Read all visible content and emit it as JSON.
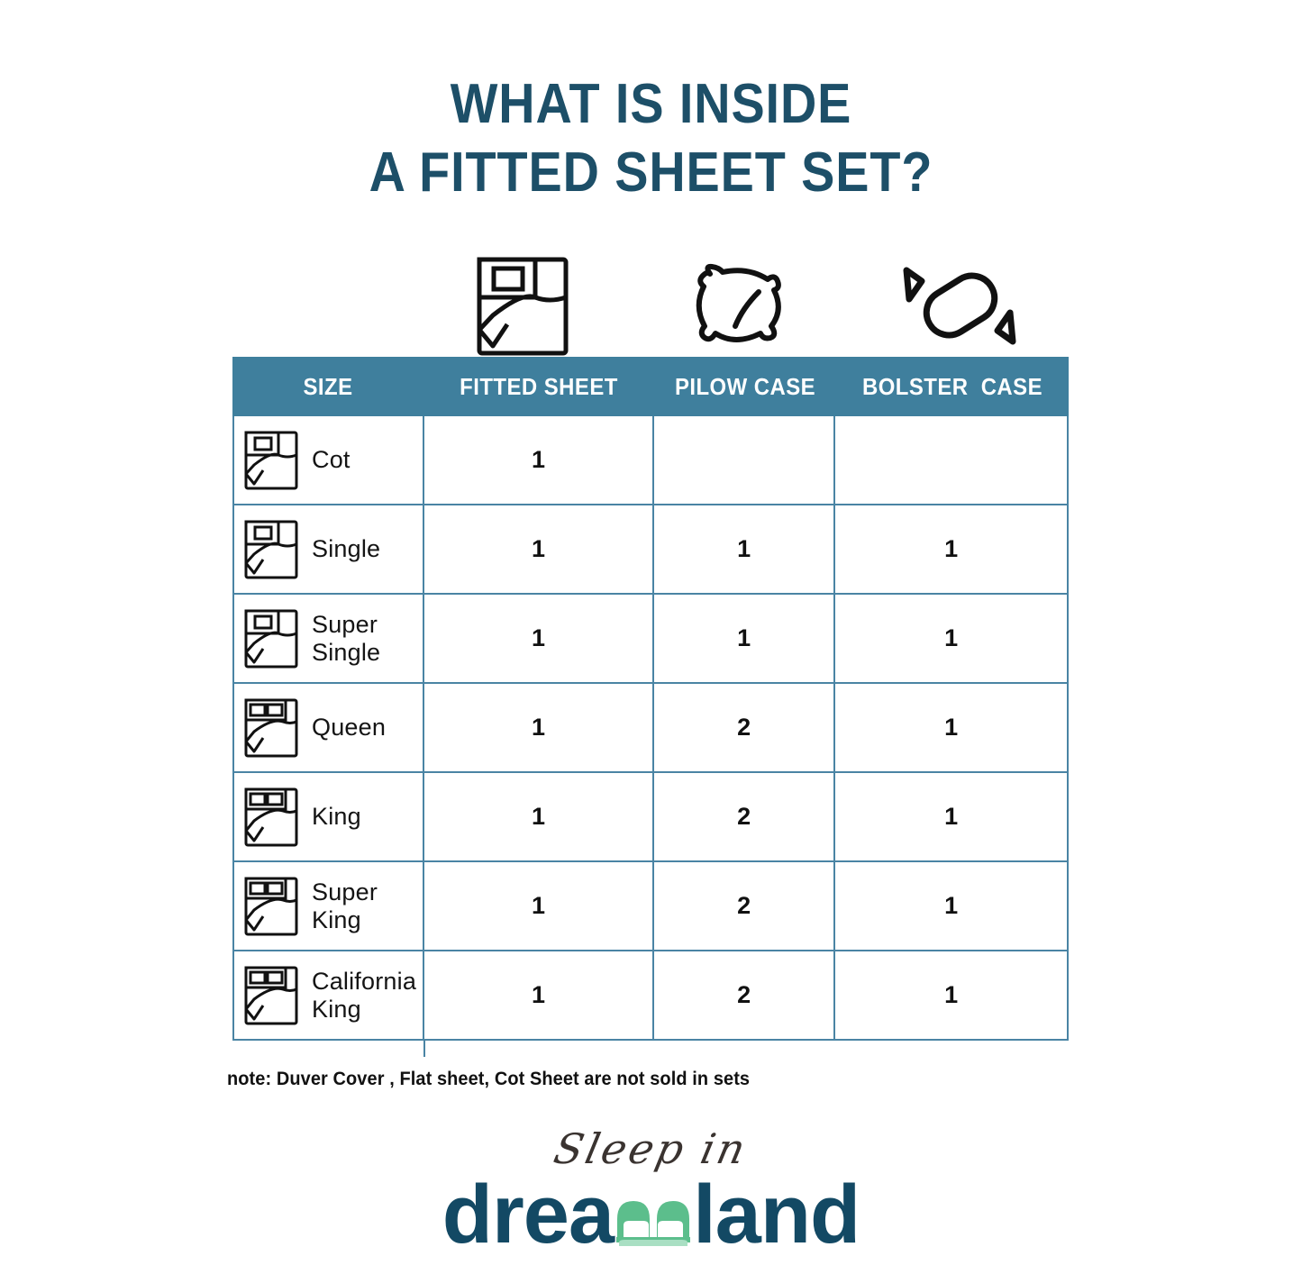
{
  "title": {
    "line1": "WHAT IS INSIDE",
    "line2": "A FITTED SHEET SET?",
    "color": "#1d4f68"
  },
  "header_icons": [
    {
      "name": "bed-icon",
      "meaning": "fitted sheet"
    },
    {
      "name": "pillow-icon",
      "meaning": "pilow case"
    },
    {
      "name": "bolster-icon",
      "meaning": "bolster case"
    }
  ],
  "table": {
    "header_bg": "#3f7f9d",
    "grid_color": "#4a84a4",
    "columns": [
      "SIZE",
      "FITTED SHEET",
      "PILOW CASE",
      "BOLSTER  CASE"
    ],
    "rows": [
      {
        "icon": "bed-single-icon",
        "size": "Cot",
        "fitted_sheet": "1",
        "pilow_case": "",
        "bolster_case": ""
      },
      {
        "icon": "bed-single-icon",
        "size": "Single",
        "fitted_sheet": "1",
        "pilow_case": "1",
        "bolster_case": "1"
      },
      {
        "icon": "bed-single-icon",
        "size": "Super\nSingle",
        "fitted_sheet": "1",
        "pilow_case": "1",
        "bolster_case": "1"
      },
      {
        "icon": "bed-double-icon",
        "size": "Queen",
        "fitted_sheet": "1",
        "pilow_case": "2",
        "bolster_case": "1"
      },
      {
        "icon": "bed-double-icon",
        "size": "King",
        "fitted_sheet": "1",
        "pilow_case": "2",
        "bolster_case": "1"
      },
      {
        "icon": "bed-double-icon",
        "size": "Super\nKing",
        "fitted_sheet": "1",
        "pilow_case": "2",
        "bolster_case": "1"
      },
      {
        "icon": "bed-double-icon",
        "size": "California\nKing",
        "fitted_sheet": "1",
        "pilow_case": "2",
        "bolster_case": "1"
      }
    ]
  },
  "note": "note: Duver Cover , Flat sheet, Cot Sheet are not sold in sets",
  "logo": {
    "script": "Sleep in",
    "word_before": "drea",
    "word_after": "land",
    "brand_color": "#134964",
    "bed_color": "#5cbe8c"
  }
}
